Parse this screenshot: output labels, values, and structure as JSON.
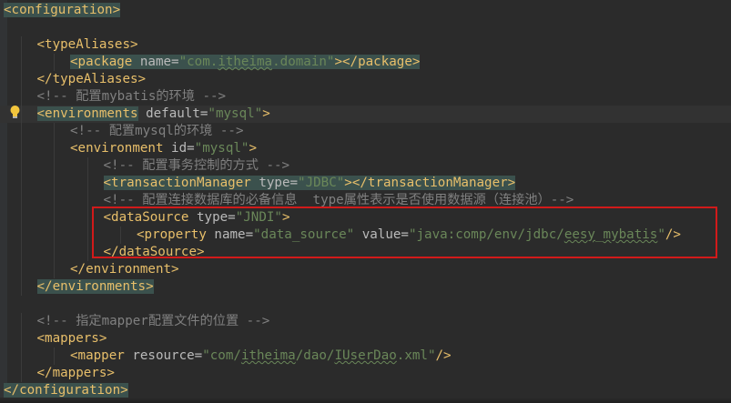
{
  "editor": {
    "lines": [
      {
        "parts": [
          {
            "t": "<configuration>",
            "c": "t",
            "h": true
          }
        ]
      },
      {
        "parts": []
      },
      {
        "parts": [
          {
            "t": "<typeAliases>",
            "c": "t"
          }
        ]
      },
      {
        "parts": [
          {
            "t": "<package",
            "c": "t",
            "h": true
          },
          {
            "t": " name=",
            "c": "a",
            "h": true
          },
          {
            "t": "\"com.",
            "c": "v",
            "h": true
          },
          {
            "t": "itheima",
            "c": "v",
            "h": true,
            "u": true
          },
          {
            "t": ".domain\"",
            "c": "v",
            "h": true
          },
          {
            "t": "></package>",
            "c": "t",
            "h": true
          }
        ]
      },
      {
        "parts": [
          {
            "t": "</typeAliases>",
            "c": "t"
          }
        ]
      },
      {
        "parts": [
          {
            "t": "<!-- 配置mybatis的环境 -->",
            "c": "c"
          }
        ]
      },
      {
        "parts": [
          {
            "t": "<environments",
            "c": "t",
            "h": true
          },
          {
            "t": " default=",
            "c": "a"
          },
          {
            "t": "\"mysql\"",
            "c": "v"
          },
          {
            "t": ">",
            "c": "t"
          }
        ]
      },
      {
        "parts": [
          {
            "t": "<!-- 配置mysql的环境 -->",
            "c": "c"
          }
        ]
      },
      {
        "parts": [
          {
            "t": "<environment",
            "c": "t"
          },
          {
            "t": " id=",
            "c": "a"
          },
          {
            "t": "\"mysql\"",
            "c": "v"
          },
          {
            "t": ">",
            "c": "t"
          }
        ]
      },
      {
        "parts": [
          {
            "t": "<!-- 配置事务控制的方式 -->",
            "c": "c"
          }
        ]
      },
      {
        "parts": [
          {
            "t": "<transactionManager",
            "c": "t",
            "h": true
          },
          {
            "t": " type=",
            "c": "a",
            "h": true
          },
          {
            "t": "\"JDBC\"",
            "c": "v",
            "h": true
          },
          {
            "t": "></transactionManager>",
            "c": "t",
            "h": true
          }
        ]
      },
      {
        "parts": [
          {
            "t": "<!-- 配置连接数据库的必备信息  type属性表示是否使用数据源（连接池）-->",
            "c": "c"
          }
        ]
      },
      {
        "parts": [
          {
            "t": "<dataSource",
            "c": "t"
          },
          {
            "t": " type=",
            "c": "a"
          },
          {
            "t": "\"JNDI\"",
            "c": "v"
          },
          {
            "t": ">",
            "c": "t"
          }
        ]
      },
      {
        "parts": [
          {
            "t": "<property",
            "c": "t"
          },
          {
            "t": " name=",
            "c": "a"
          },
          {
            "t": "\"data_source\"",
            "c": "v"
          },
          {
            "t": " value=",
            "c": "a"
          },
          {
            "t": "\"java:comp/env/jdbc/",
            "c": "v"
          },
          {
            "t": "eesy",
            "c": "v",
            "u": true
          },
          {
            "t": "_",
            "c": "v"
          },
          {
            "t": "mybatis",
            "c": "v",
            "u": true
          },
          {
            "t": "\"",
            "c": "v"
          },
          {
            "t": "/>",
            "c": "t"
          }
        ]
      },
      {
        "parts": [
          {
            "t": "</dataSource>",
            "c": "t"
          }
        ]
      },
      {
        "parts": [
          {
            "t": "</environment>",
            "c": "t"
          }
        ]
      },
      {
        "parts": [
          {
            "t": "</environments>",
            "c": "t",
            "h": true
          }
        ]
      },
      {
        "parts": []
      },
      {
        "parts": [
          {
            "t": "<!-- 指定mapper配置文件的位置 -->",
            "c": "c"
          }
        ]
      },
      {
        "parts": [
          {
            "t": "<mappers>",
            "c": "t"
          }
        ]
      },
      {
        "parts": [
          {
            "t": "<mapper",
            "c": "t"
          },
          {
            "t": " resource=",
            "c": "a"
          },
          {
            "t": "\"com/",
            "c": "v"
          },
          {
            "t": "itheima",
            "c": "v",
            "u": true
          },
          {
            "t": "/dao/",
            "c": "v"
          },
          {
            "t": "IUserDao",
            "c": "v",
            "u": true
          },
          {
            "t": ".xml\"",
            "c": "v"
          },
          {
            "t": "/>",
            "c": "t"
          }
        ]
      },
      {
        "parts": [
          {
            "t": "</mappers>",
            "c": "t"
          }
        ]
      },
      {
        "parts": [
          {
            "t": "</configuration>",
            "c": "t",
            "h": true
          }
        ]
      }
    ]
  },
  "icons": {
    "intention_bulb": "lightbulb-icon"
  },
  "colors": {
    "background": "#2b2b2b",
    "tag": "#e8bf6a",
    "attribute": "#bababa",
    "value": "#6a8759",
    "comment": "#808080",
    "tag_match_highlight": "#3b514d",
    "annotation_box": "#d11a1a"
  }
}
